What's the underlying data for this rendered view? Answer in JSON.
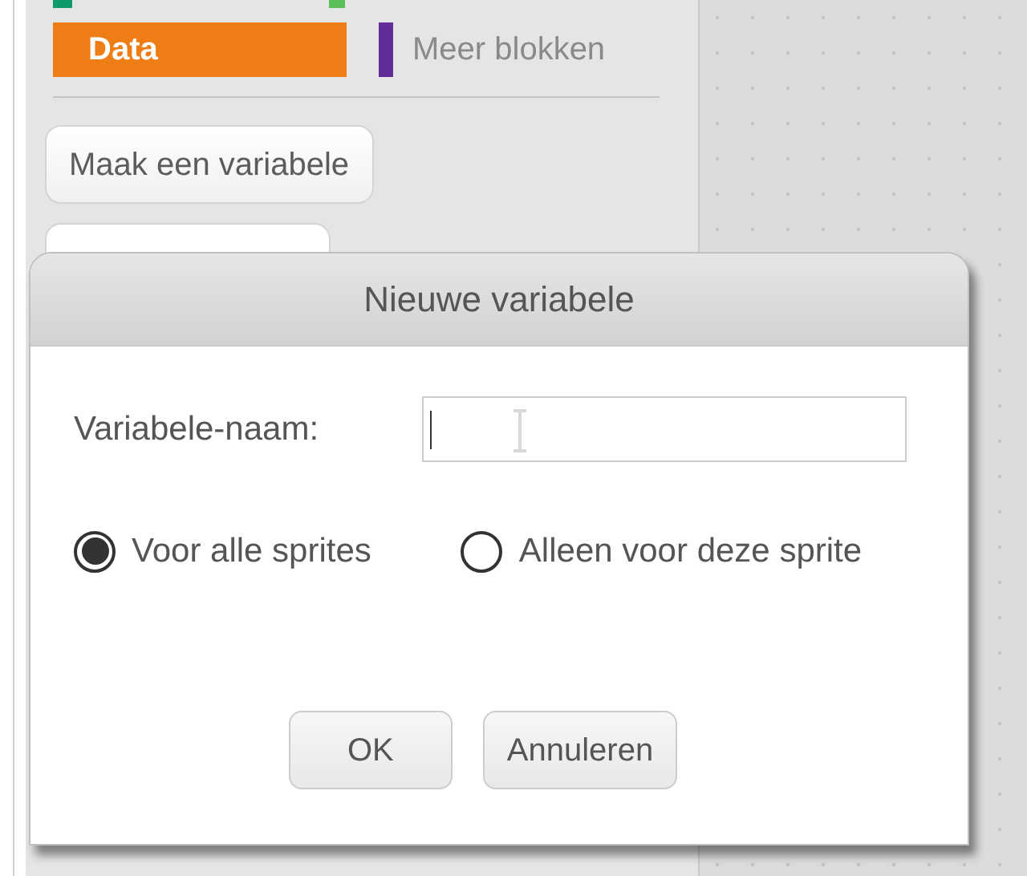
{
  "palette": {
    "categories": [
      {
        "label": "Data",
        "color": "#ee7d16",
        "selected": true
      },
      {
        "label": "Meer blokken",
        "color": "#632d99",
        "selected": false
      }
    ],
    "buttons": [
      "Maak een variabele"
    ]
  },
  "dialog": {
    "title": "Nieuwe variabele",
    "field_label": "Variabele-naam:",
    "options": [
      {
        "label": "Voor alle sprites",
        "selected": true
      },
      {
        "label": "Alleen voor deze sprite",
        "selected": false
      }
    ],
    "buttons": [
      "OK",
      "Annuleren"
    ]
  }
}
